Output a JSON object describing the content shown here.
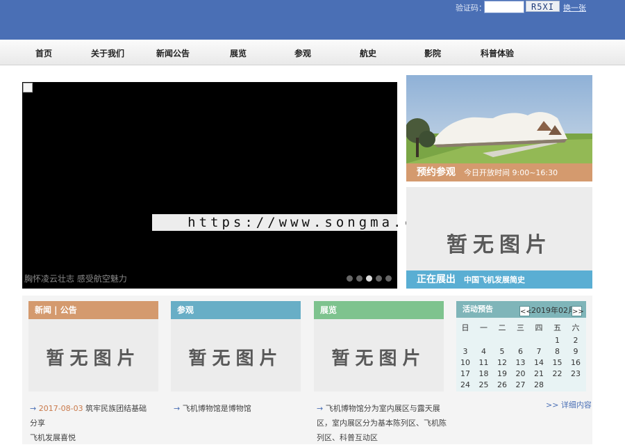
{
  "captcha": {
    "label": "验证码：",
    "value": "",
    "code": "R5XI",
    "refresh": "换一张"
  },
  "nav": [
    "首页",
    "关于我们",
    "新闻公告",
    "展览",
    "参观",
    "航史",
    "影院",
    "科普体验"
  ],
  "slider": {
    "caption": "胸怀凌云壮志 感受航空魅力",
    "slide_count": 5,
    "active_index": 2
  },
  "watermark": "https://www.songma.com",
  "visit": {
    "title": "预约参观",
    "hours": "今日开放时间 9:00~16:30",
    "color": "#d49a6e"
  },
  "exhibit": {
    "placeholder": "暂无图片",
    "title": "正在展出",
    "subtitle": "中国飞机发展简史",
    "color": "#5aaed3"
  },
  "columns": [
    {
      "title": "新闻 | 公告",
      "color": "#d49a6e",
      "placeholder": "暂无图片",
      "item": {
        "date": "2017-08-03",
        "text_line1": "筑牢民族团结基础　分享",
        "text_line2": "飞机发展喜悦"
      }
    },
    {
      "title": "参观",
      "color": "#68aec6",
      "placeholder": "暂无图片",
      "item": {
        "text_line1": "飞机博物馆是博物馆"
      }
    },
    {
      "title": "展览",
      "color": "#7ec38e",
      "placeholder": "暂无图片",
      "item": {
        "text_line1": "飞机博物馆分为室内展区与露天展",
        "text_line2": "区，室内展区分为基本陈列区、飞机陈",
        "text_line3": "列区、科普互动区"
      }
    }
  ],
  "calendar": {
    "title": "活动预告",
    "prev": "<<",
    "next": ">>",
    "month": "2019年02月",
    "weekdays": [
      "日",
      "一",
      "二",
      "三",
      "四",
      "五",
      "六"
    ],
    "first_weekday": 5,
    "days_in_month": 28
  },
  "more": ">> 详细内容"
}
